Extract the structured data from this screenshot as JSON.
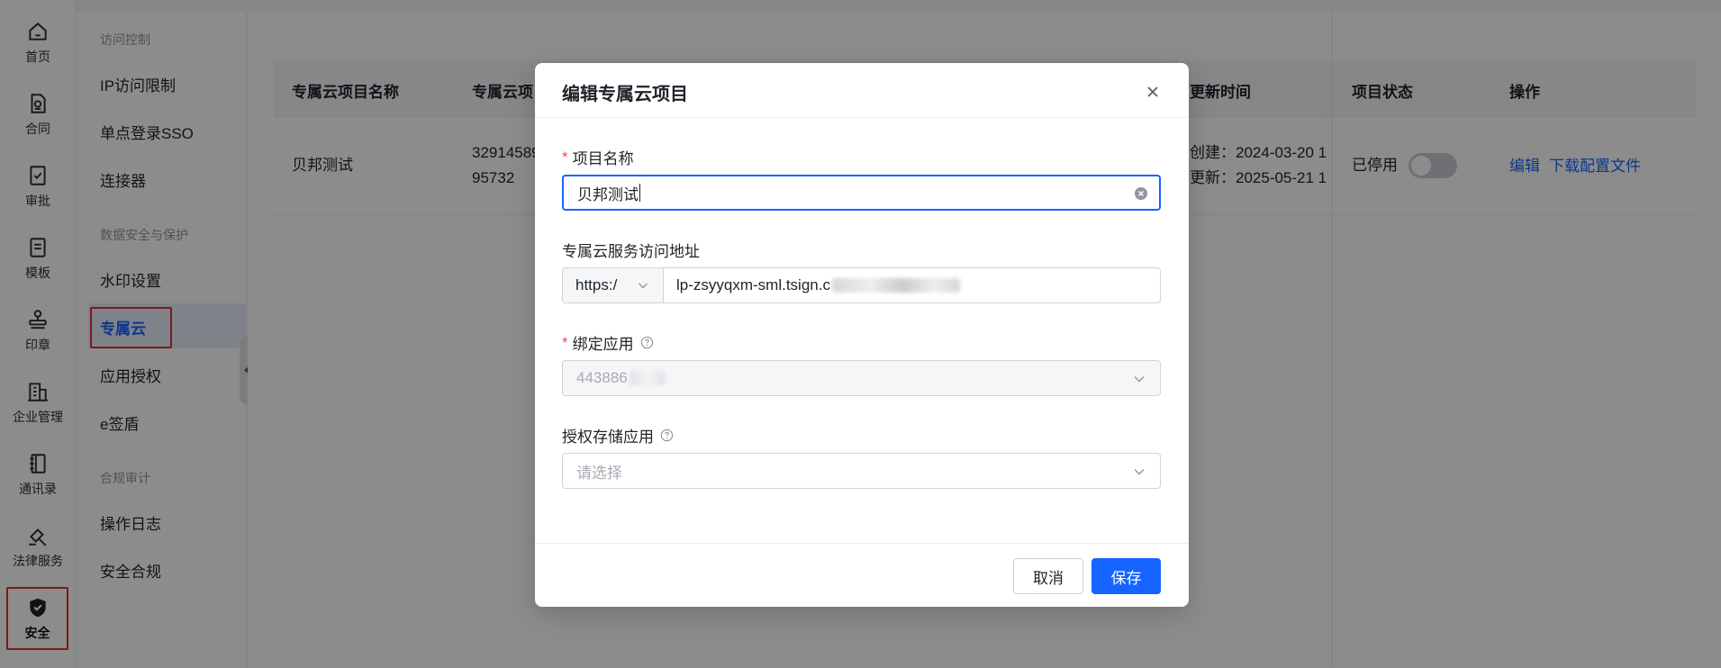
{
  "rail": {
    "items": [
      {
        "label": "首页",
        "icon": "home-icon"
      },
      {
        "label": "合同",
        "icon": "contract-icon"
      },
      {
        "label": "审批",
        "icon": "approval-icon"
      },
      {
        "label": "模板",
        "icon": "template-icon"
      },
      {
        "label": "印章",
        "icon": "seal-icon"
      },
      {
        "label": "企业管理",
        "icon": "enterprise-icon"
      },
      {
        "label": "通讯录",
        "icon": "contacts-icon"
      },
      {
        "label": "法律服务",
        "icon": "legal-icon"
      },
      {
        "label": "安全",
        "icon": "shield-icon",
        "active": true
      }
    ]
  },
  "sidebar": {
    "groups": [
      {
        "title": "访问控制",
        "items": [
          "IP访问限制",
          "单点登录SSO",
          "连接器"
        ]
      },
      {
        "title": "数据安全与保护",
        "items": [
          "水印设置",
          "专属云",
          "应用授权",
          "e签盾"
        ]
      },
      {
        "title": "合规审计",
        "items": [
          "操作日志",
          "安全合规"
        ]
      }
    ],
    "active": "专属云"
  },
  "table": {
    "headers": {
      "name": "专属云项目名称",
      "id": "专属云项",
      "time": "更新时间",
      "status": "项目状态",
      "ops": "操作"
    },
    "row": {
      "name": "贝邦测试",
      "id_line1": "32914589",
      "id_line2": "95732",
      "created": "创建：2024-03-20 1",
      "updated": "更新：2025-05-21 1",
      "status": "已停用",
      "status_on": false,
      "edit": "编辑",
      "download": "下载配置文件"
    }
  },
  "modal": {
    "title": "编辑专属云项目",
    "fields": {
      "name": {
        "label": "项目名称",
        "required": true,
        "value": "贝邦测试"
      },
      "address": {
        "label": "专属云服务访问地址",
        "protocol": "https:/",
        "value": "lp-zsyyqxm-sml.tsign.c"
      },
      "app": {
        "label": "绑定应用",
        "required": true,
        "value": "443886",
        "disabled": true
      },
      "storage": {
        "label": "授权存储应用",
        "placeholder": "请选择"
      }
    },
    "cancel_label": "取消",
    "save_label": "保存"
  },
  "colors": {
    "primary": "#1664ff",
    "required": "#f54a45",
    "highlight": "#e03131",
    "overlay": "rgba(0,0,0,0.45)"
  }
}
